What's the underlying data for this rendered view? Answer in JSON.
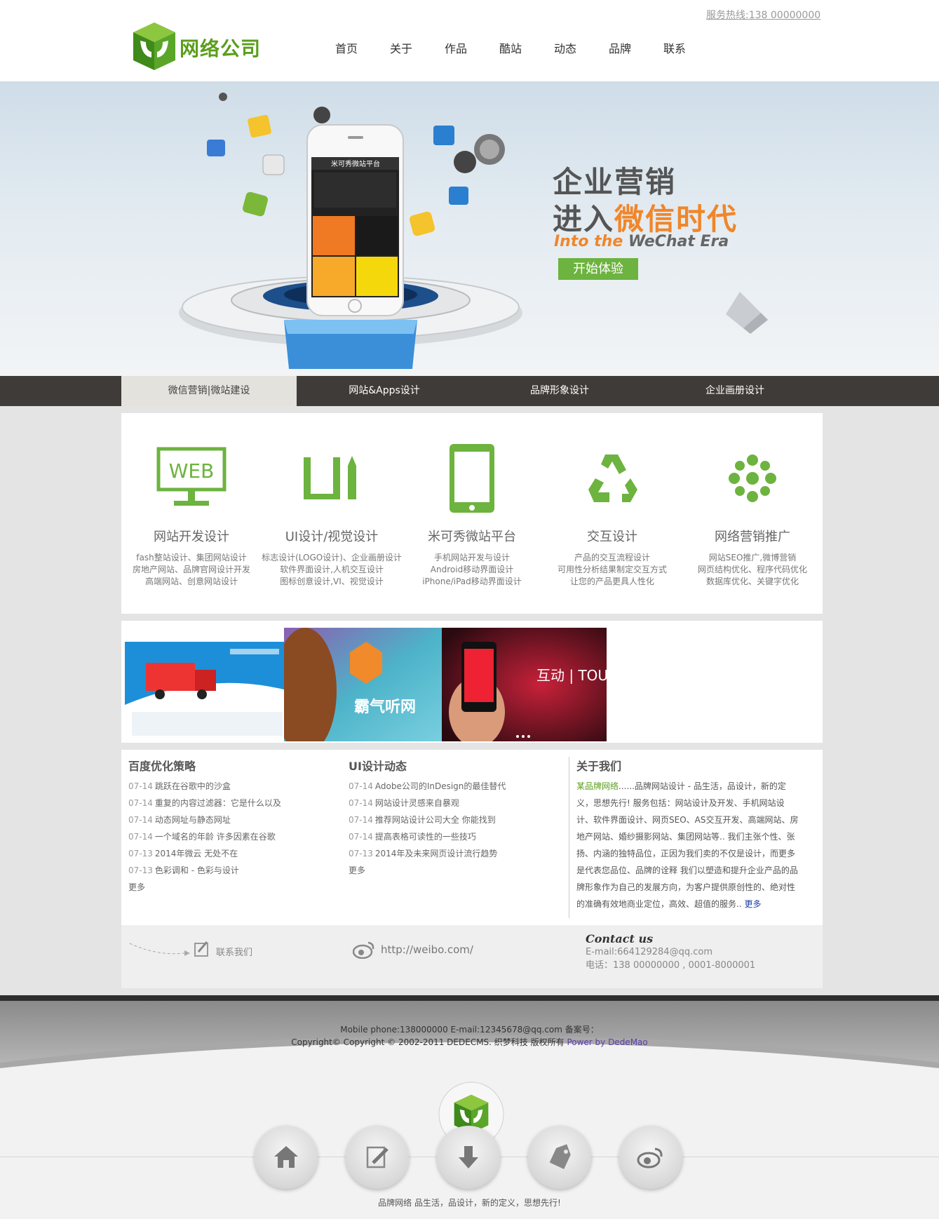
{
  "header": {
    "hotline": "服务热线:138 00000000",
    "logo_text": "网络公司",
    "nav": [
      "首页",
      "关于",
      "作品",
      "酷站",
      "动态",
      "品牌",
      "联系"
    ]
  },
  "banner": {
    "line1": "企业营销",
    "line2_prefix": "进入",
    "line2_highlight": "微信时代",
    "en_highlight": "Into the",
    "en_rest": " WeChat Era",
    "button": "开始体验",
    "phone_title": "米可秀微站平台"
  },
  "tabs": [
    "微信营销|微站建设",
    "网站&Apps设计",
    "品牌形象设计",
    "企业画册设计"
  ],
  "services": [
    {
      "icon": "web-monitor-icon",
      "title": "网站开发设计",
      "desc": "fash整站设计、集团网站设计\n房地产网站、品牌官网设计开发\n高端网站、创意网站设计"
    },
    {
      "icon": "ui-pencil-icon",
      "title": "UI设计/视觉设计",
      "desc": "标志设计(LOGO设计)、企业画册设计\n软件界面设计,人机交互设计\n图标创意设计,VI、视觉设计"
    },
    {
      "icon": "smartphone-icon",
      "title": "米可秀微站平台",
      "desc": "手机网站开发与设计\nAndroid移动界面设计\niPhone/iPad移动界面设计"
    },
    {
      "icon": "recycle-icon",
      "title": "交互设计",
      "desc": "产品的交互流程设计\n可用性分析结果制定交互方式\n让您的产品更具人性化"
    },
    {
      "icon": "flower-icon",
      "title": "网络营销推广",
      "desc": "网站SEO推广,微博营销\n网页结构优化、程序代码优化\n数据库优化、关键字优化"
    }
  ],
  "works": [
    {
      "caption": ""
    },
    {
      "caption": "霸气听网"
    },
    {
      "caption": "互动 | TOU"
    }
  ],
  "news": {
    "baidu": {
      "title": "百度优化策略",
      "items": [
        {
          "date": "07-14",
          "text": "跳跃在谷歌中的沙盒"
        },
        {
          "date": "07-14",
          "text": "重复的内容过滤器：它是什么以及"
        },
        {
          "date": "07-14",
          "text": "动态网址与静态网址"
        },
        {
          "date": "07-14",
          "text": "一个域名的年龄 许多因素在谷歌"
        },
        {
          "date": "07-13",
          "text": "2014年微云 无处不在"
        },
        {
          "date": "07-13",
          "text": "色彩调和 - 色彩与设计"
        }
      ],
      "more": "更多"
    },
    "ui": {
      "title": "UI设计动态",
      "items": [
        {
          "date": "07-14",
          "text": "Adobe公司的InDesign的最佳替代"
        },
        {
          "date": "07-14",
          "text": "网站设计灵感来自暴观"
        },
        {
          "date": "07-14",
          "text": "推荐网站设计公司大全 你能找到"
        },
        {
          "date": "07-14",
          "text": "提高表格可读性的一些技巧"
        },
        {
          "date": "07-13",
          "text": "2014年及未来网页设计流行趋势"
        }
      ],
      "more": "更多"
    },
    "about": {
      "title": "关于我们",
      "brand": "某品牌网络",
      "body": "......品牌网站设计 - 品生活，品设计，新的定义，思想先行! 服务包括：网站设计及开发、手机网站设计、软件界面设计、网页SEO、AS交互开发、高端网站、房地产网站、婚纱摄影网站、集团网站等.. 我们主张个性、张扬、内涵的独特品位，正因为我们卖的不仅是设计，而更多是代表您品位、品牌的诠释 我们以塑造和提升企业产品的品牌形象作为自己的发展方向，为客户提供原创性的、绝对性的准确有效地商业定位，高效、超值的服务..",
      "more": "更多"
    }
  },
  "contact": {
    "link": "联系我们",
    "weibo": "http://weibo.com/",
    "title": "Contact us",
    "email": "E-mail:664129284@qq.com",
    "phone": "电话：138 00000000 , 0001-8000001"
  },
  "footer": {
    "line1": "Mobile phone:138000000  E-mail:12345678@qq.com  备案号：",
    "line2": "Copyright© Copyright © 2002-2011 DEDECMS. 织梦科技 版权所有 ",
    "power": "Power by DedeMao",
    "slogan": "品牌网络 品生活，品设计，新的定义，思想先行!",
    "buttons": [
      "home-icon",
      "edit-icon",
      "download-icon",
      "blog-tag-icon",
      "weibo-icon"
    ]
  },
  "colors": {
    "accent_green": "#6db33f",
    "logo_green": "#5a9e1c",
    "accent_orange": "#f0862a",
    "tabbar": "#3f3b38"
  }
}
